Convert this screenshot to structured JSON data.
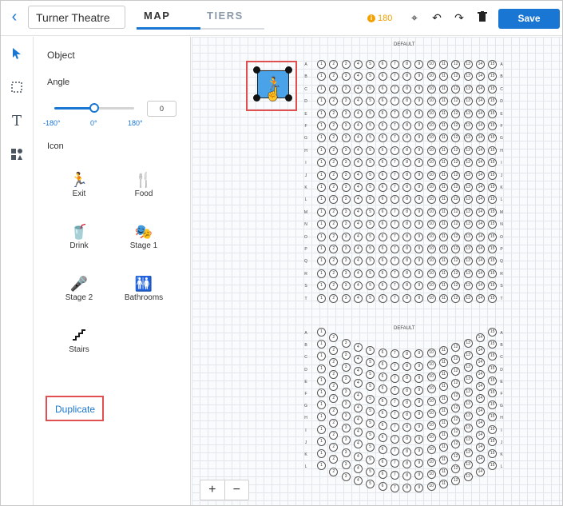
{
  "topbar": {
    "back_icon": "chevron-left-icon",
    "title": "Turner Theatre",
    "tabs": [
      "MAP",
      "TIERS"
    ],
    "active_tab": "MAP",
    "points": "180",
    "tools": [
      "crosshair-icon",
      "undo-icon",
      "redo-icon",
      "trash-icon"
    ],
    "save_label": "Save",
    "accent_color": "#1976d2"
  },
  "rail": [
    "pointer-icon",
    "select-box-icon",
    "text-icon",
    "shapes-icon"
  ],
  "panel": {
    "section": "Object",
    "angle_label": "Angle",
    "angle_value": "0",
    "angle_min": "-180°",
    "angle_mid": "0°",
    "angle_max": "180°",
    "slider_fraction": 0.5,
    "icon_label": "Icon",
    "icons": [
      {
        "label": "Exit",
        "icon": "exit-icon"
      },
      {
        "label": "Food",
        "icon": "food-icon"
      },
      {
        "label": "Drink",
        "icon": "drink-icon"
      },
      {
        "label": "Stage 1",
        "icon": "theatre-masks-icon"
      },
      {
        "label": "Stage 2",
        "icon": "microphone-icon"
      },
      {
        "label": "Bathrooms",
        "icon": "bathrooms-icon"
      },
      {
        "label": "Stairs",
        "icon": "stairs-icon"
      }
    ],
    "duplicate_label": "Duplicate"
  },
  "canvas": {
    "section1": {
      "label": "DEFAULT",
      "rows": [
        "A",
        "B",
        "C",
        "D",
        "E",
        "F",
        "G",
        "H",
        "I",
        "J",
        "K",
        "L",
        "M",
        "N",
        "O",
        "P",
        "Q",
        "R",
        "S",
        "T"
      ],
      "seats": [
        "1",
        "2",
        "3",
        "4",
        "5",
        "6",
        "7",
        "8",
        "9",
        "10",
        "11",
        "12",
        "13",
        "14",
        "15"
      ]
    },
    "section2": {
      "label": "DEFAULT",
      "rows": [
        "A",
        "B",
        "C",
        "D",
        "E",
        "F",
        "G",
        "H",
        "I",
        "J",
        "K",
        "L"
      ],
      "seats": [
        "1",
        "2",
        "3",
        "4",
        "5",
        "6",
        "7",
        "8",
        "9",
        "10",
        "11",
        "12",
        "13",
        "14",
        "15"
      ]
    },
    "selected_object": "exit-icon",
    "zoom_in": "+",
    "zoom_out": "−"
  }
}
